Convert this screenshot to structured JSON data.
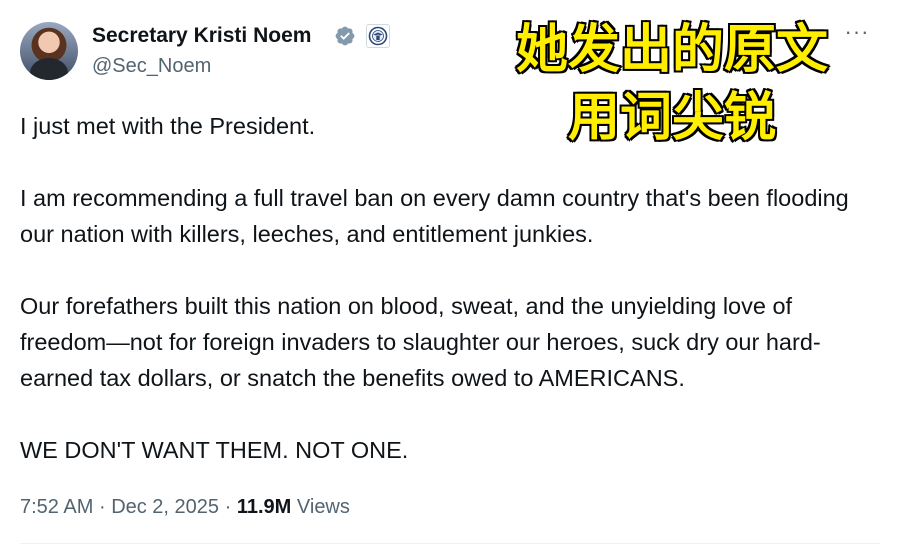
{
  "author": {
    "display_name": "Secretary Kristi Noem",
    "handle": "@Sec_Noem"
  },
  "more_label": "···",
  "caption": {
    "line1": "她发出的原文",
    "line2": "用词尖锐"
  },
  "tweet": {
    "paragraphs": [
      "I just met with the President.",
      "I am recommending a full travel ban on every damn country that's been flooding our nation with killers, leeches, and entitlement junkies.",
      "Our forefathers built this nation on blood, sweat, and the unyielding love of freedom—not for foreign invaders to slaughter our heroes, suck dry our hard-earned tax dollars, or snatch the benefits owed to AMERICANS.",
      "WE DON'T WANT THEM. NOT ONE."
    ]
  },
  "meta": {
    "time": "7:52 AM",
    "separator": "·",
    "date": "Dec 2, 2025",
    "views_count": "11.9M",
    "views_label": "Views"
  },
  "colors": {
    "text": "#0f1419",
    "secondary": "#536471",
    "verified": "#829aab",
    "caption_fill": "#ffee00"
  },
  "icons": {
    "verified": "verified-badge-icon",
    "affiliate": "dhs-seal-icon",
    "more": "more-horizontal-icon"
  }
}
